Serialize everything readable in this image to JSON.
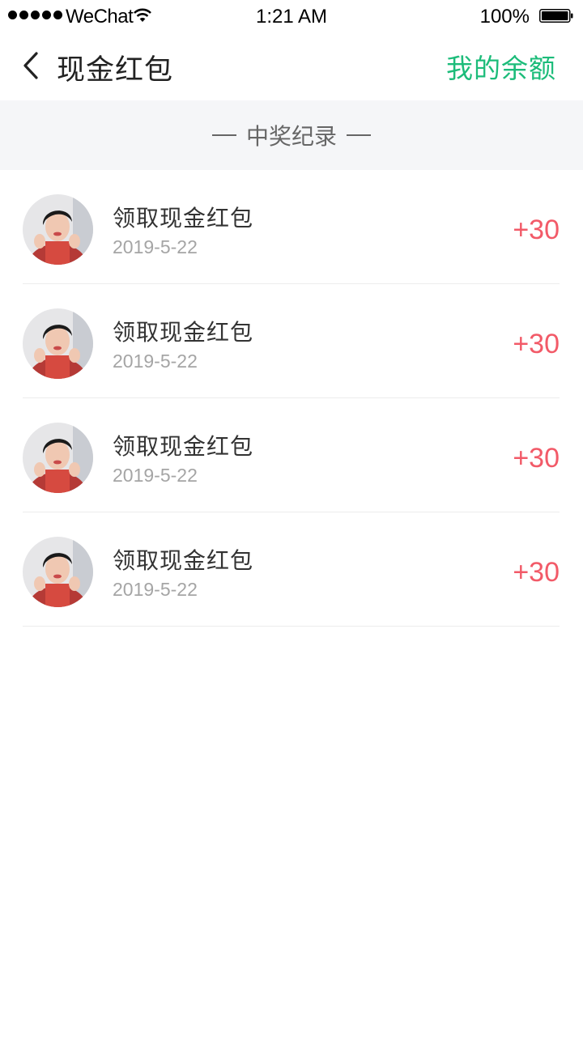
{
  "status_bar": {
    "carrier": "WeChat",
    "time": "1:21 AM",
    "battery": "100%"
  },
  "nav": {
    "title": "现金红包",
    "balance_link": "我的余额",
    "back_icon": "chevron-left-icon"
  },
  "section": {
    "title": "中奖纪录"
  },
  "records": [
    {
      "title": "领取现金红包",
      "date": "2019-5-22",
      "amount": "+30"
    },
    {
      "title": "领取现金红包",
      "date": "2019-5-22",
      "amount": "+30"
    },
    {
      "title": "领取现金红包",
      "date": "2019-5-22",
      "amount": "+30"
    },
    {
      "title": "领取现金红包",
      "date": "2019-5-22",
      "amount": "+30"
    }
  ],
  "colors": {
    "accent_green": "#1cbc7a",
    "amount_red": "#f25a68",
    "section_bg": "#f5f6f8"
  }
}
